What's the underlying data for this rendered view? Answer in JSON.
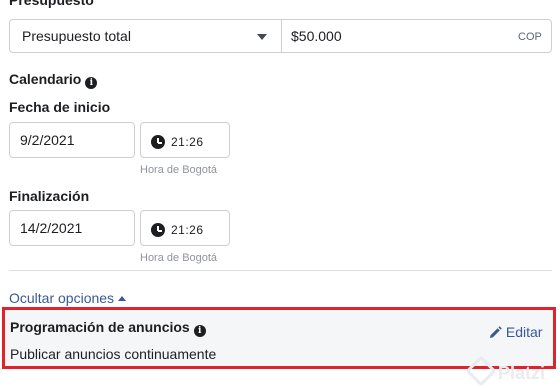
{
  "budget": {
    "section_title": "Presupuesto",
    "type_value": "Presupuesto total",
    "amount_value": "$50.000",
    "currency": "COP"
  },
  "schedule": {
    "section_title": "Calendario",
    "start": {
      "label": "Fecha de inicio",
      "date": "9/2/2021",
      "time": "21:26",
      "timezone": "Hora de Bogotá"
    },
    "end": {
      "label": "Finalización",
      "date": "14/2/2021",
      "time": "21:26",
      "timezone": "Hora de Bogotá"
    }
  },
  "options": {
    "toggle_label": "Ocultar opciones"
  },
  "ad_scheduling": {
    "title": "Programación de anuncios",
    "edit_label": "Editar",
    "value": "Publicar anuncios continuamente"
  },
  "watermark": "Platzi",
  "colors": {
    "link": "#385898",
    "highlight_border": "#e0222c",
    "divider": "#dddfe2"
  }
}
